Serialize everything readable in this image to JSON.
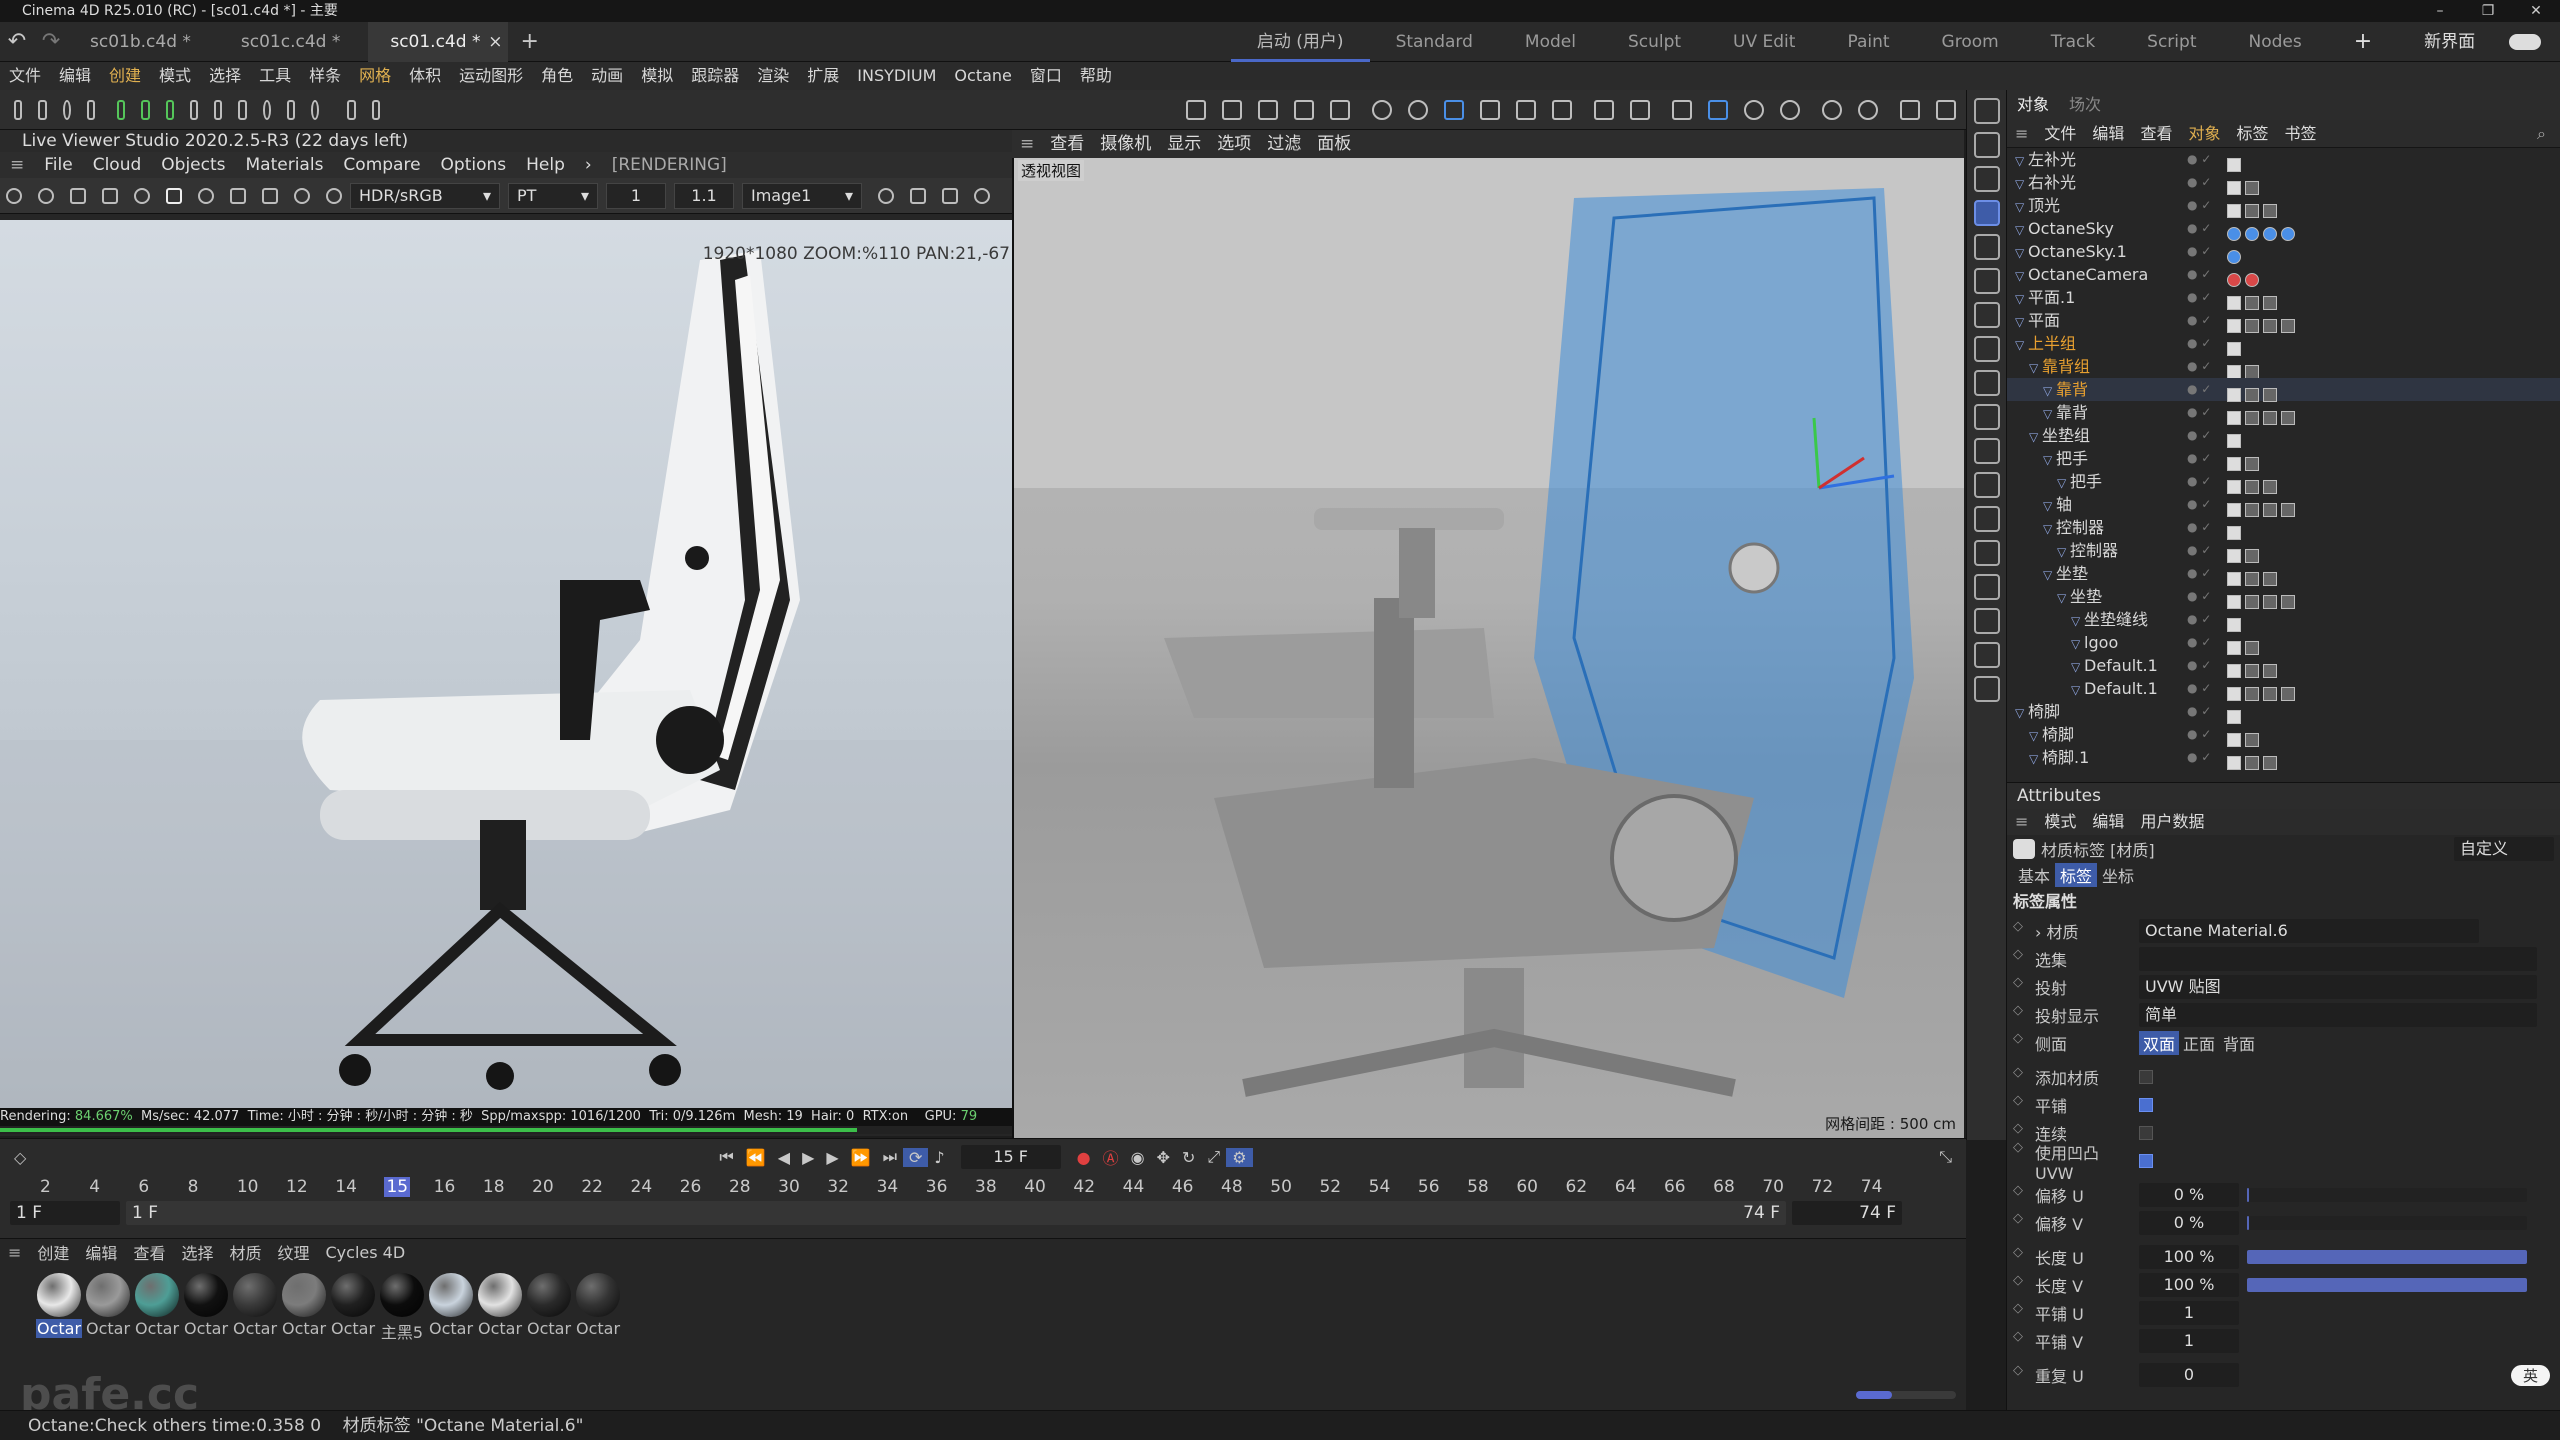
{
  "app": {
    "title": "Cinema 4D R25.010 (RC) - [sc01.c4d *] - 主要",
    "window_controls": [
      "–",
      "❐",
      "✕"
    ]
  },
  "doc_tabs": [
    "sc01b.c4d *",
    "sc01c.c4d *",
    "sc01.c4d *"
  ],
  "doc_tab_close": "×",
  "new_tab": "+",
  "layouts": [
    "启动 (用户)",
    "Standard",
    "Model",
    "Sculpt",
    "UV Edit",
    "Paint",
    "Groom",
    "Track",
    "Script",
    "Nodes",
    "+",
    "新界面"
  ],
  "menu": [
    "文件",
    "编辑",
    "创建",
    "模式",
    "选择",
    "工具",
    "样条",
    "网格",
    "体积",
    "运动图形",
    "角色",
    "动画",
    "模拟",
    "跟踪器",
    "渲染",
    "扩展",
    "INSYDIUM",
    "Octane",
    "窗口",
    "帮助"
  ],
  "live_viewer": {
    "title": "Live Viewer Studio 2020.2.5-R3 (22 days left)",
    "menu": [
      "File",
      "Cloud",
      "Objects",
      "Materials",
      "Compare",
      "Options",
      "Help",
      "›",
      "[RENDERING]"
    ],
    "colorspace": "HDR/sRGB",
    "kernel": "PT",
    "spin1": "1",
    "spin2": "1.1",
    "image": "Image1",
    "zoom_text": "1920*1080 ZOOM:%110  PAN:21,-67",
    "status": {
      "rendering_label": "Rendering:",
      "rendering_pct": "84.667%",
      "ms": "Ms/sec: 42.077",
      "time": "Time: 小时 : 分钟 : 秒/小时 : 分钟 : 秒",
      "spp": "Spp/maxspp: 1016/1200",
      "tri": "Tri: 0/9.126m",
      "mesh": "Mesh: 19",
      "hair": "Hair: 0",
      "rtx": "RTX:on",
      "gpu_label": "GPU:",
      "gpu_val": "79"
    },
    "progress": 0.847
  },
  "viewport": {
    "menu": [
      "查看",
      "摄像机",
      "显示",
      "选项",
      "过滤",
      "面板"
    ],
    "name": "透视视图",
    "grid": "网格间距 : 500 cm"
  },
  "object_manager": {
    "tabs": [
      "对象",
      "场次"
    ],
    "menu": [
      "文件",
      "编辑",
      "查看",
      "对象",
      "标签",
      "书签"
    ],
    "rows": [
      {
        "name": "左补光",
        "indent": 0,
        "color": "normal"
      },
      {
        "name": "右补光",
        "indent": 0,
        "color": "normal"
      },
      {
        "name": "顶光",
        "indent": 0,
        "color": "normal"
      },
      {
        "name": "OctaneSky",
        "indent": 0,
        "color": "normal"
      },
      {
        "name": "OctaneSky.1",
        "indent": 0,
        "color": "normal"
      },
      {
        "name": "OctaneCamera",
        "indent": 0,
        "color": "normal"
      },
      {
        "name": "平面.1",
        "indent": 0,
        "color": "normal"
      },
      {
        "name": "平面",
        "indent": 0,
        "color": "normal"
      },
      {
        "name": "上半组",
        "indent": 0,
        "color": "orange"
      },
      {
        "name": "靠背组",
        "indent": 1,
        "color": "orange"
      },
      {
        "name": "靠背",
        "indent": 2,
        "color": "orange",
        "selected": true
      },
      {
        "name": "靠背",
        "indent": 2,
        "color": "normal"
      },
      {
        "name": "坐垫组",
        "indent": 1,
        "color": "normal"
      },
      {
        "name": "把手",
        "indent": 2,
        "color": "normal"
      },
      {
        "name": "把手",
        "indent": 3,
        "color": "normal"
      },
      {
        "name": "轴",
        "indent": 2,
        "color": "normal"
      },
      {
        "name": "控制器",
        "indent": 2,
        "color": "normal"
      },
      {
        "name": "控制器",
        "indent": 3,
        "color": "normal"
      },
      {
        "name": "坐垫",
        "indent": 2,
        "color": "normal"
      },
      {
        "name": "坐垫",
        "indent": 3,
        "color": "normal"
      },
      {
        "name": "坐垫缝线",
        "indent": 4,
        "color": "normal"
      },
      {
        "name": "lgoo",
        "indent": 4,
        "color": "normal"
      },
      {
        "name": "Default.1",
        "indent": 4,
        "color": "normal"
      },
      {
        "name": "Default.1",
        "indent": 4,
        "color": "normal"
      },
      {
        "name": "椅脚",
        "indent": 0,
        "color": "normal"
      },
      {
        "name": "椅脚",
        "indent": 1,
        "color": "normal"
      },
      {
        "name": "椅脚.1",
        "indent": 1,
        "color": "normal"
      }
    ]
  },
  "attributes": {
    "panel_title": "Attributes",
    "menu": [
      "模式",
      "编辑",
      "用户数据"
    ],
    "header": "材质标签 [材质]",
    "preset": "自定义",
    "subtabs": [
      "基本",
      "标签",
      "坐标"
    ],
    "section": "标签属性",
    "material_label": "› 材质",
    "material_value": "Octane Material.6",
    "selection_label": "选集",
    "projection_label": "投射",
    "projection_value": "UVW 贴图",
    "projection_display_label": "投射显示",
    "projection_display_value": "简单",
    "side_label": "侧面",
    "side_options": [
      "双面",
      "正面",
      "背面"
    ],
    "add_material_label": "添加材质",
    "tile_label": "平铺",
    "continuous_label": "连续",
    "use_bump_uvw_label": "使用凹凸 UVW",
    "offset_u_label": "偏移 U",
    "offset_u": "0 %",
    "offset_v_label": "偏移 V",
    "offset_v": "0 %",
    "length_u_label": "长度 U",
    "length_u": "100 %",
    "length_v_label": "长度 V",
    "length_v": "100 %",
    "tiles_u_label": "平铺 U",
    "tiles_u": "1",
    "tiles_v_label": "平铺 V",
    "tiles_v": "1",
    "repeat_u_label": "重复 U",
    "repeat_u": "0",
    "checks": {
      "add_material": false,
      "tile": true,
      "continuous": false,
      "use_bump_uvw": true
    }
  },
  "timeline": {
    "current_frame": "15 F",
    "ruler": [
      "2",
      "4",
      "6",
      "8",
      "10",
      "12",
      "14",
      "15",
      "16",
      "18",
      "20",
      "22",
      "24",
      "26",
      "28",
      "30",
      "32",
      "34",
      "36",
      "38",
      "40",
      "42",
      "44",
      "46",
      "48",
      "50",
      "52",
      "54",
      "56",
      "58",
      "60",
      "62",
      "64",
      "66",
      "68",
      "70",
      "72",
      "74"
    ],
    "start": "1 F",
    "start2": "1 F",
    "end": "74 F",
    "end2": "74 F"
  },
  "material_manager": {
    "menu": [
      "创建",
      "编辑",
      "查看",
      "选择",
      "材质",
      "纹理",
      "Cycles 4D"
    ],
    "materials": [
      {
        "label": "Octar",
        "color": "#e8e8e8",
        "selected": true
      },
      {
        "label": "Octar",
        "color": "#9a9a9a"
      },
      {
        "label": "Octar",
        "color": "#4e9e96"
      },
      {
        "label": "Octar",
        "color": "#111111"
      },
      {
        "label": "Octar",
        "color": "#3a3a3a"
      },
      {
        "label": "Octar",
        "color": "#7c7c7c"
      },
      {
        "label": "Octar",
        "color": "#202020"
      },
      {
        "label": "主黑5",
        "color": "#0c0c0c"
      },
      {
        "label": "Octar",
        "color": "#c9d3dd"
      },
      {
        "label": "Octar",
        "color": "#e2e2e2"
      },
      {
        "label": "Octar",
        "color": "#2a2a2a"
      },
      {
        "label": "Octar",
        "color": "#333333"
      }
    ]
  },
  "status_bar": {
    "left": "Octane:Check others time:0.358  0",
    "right": "材质标签 \"Octane Material.6\""
  },
  "watermark": "pafe.cc",
  "ime": "英"
}
